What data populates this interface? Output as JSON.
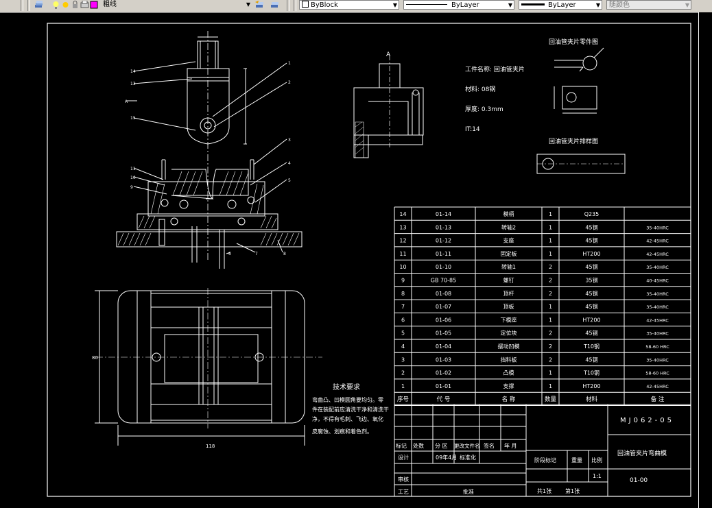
{
  "toolbar": {
    "layer_name": "粗线",
    "color_control": "ByBlock",
    "linetype_control": "ByLayer",
    "lineweight_control": "ByLayer",
    "plotstyle_control": "随颜色"
  },
  "drawing": {
    "section_label_a": "A",
    "part_drawing_title": "回油管夹片零件图",
    "blank_drawing_title": "回油管夹片排样图",
    "workpiece_name": "工件名称: 回油管夹片",
    "material": "材料: 08钢",
    "thickness": "厚度: 0.3mm",
    "tolerance": "IT:14",
    "tech_req_title": "技术要求",
    "tech_req_lines": [
      "弯曲凸、凹模圆角要均匀。零",
      "件在装配前应清洗干净和清洗干",
      "净，不得有毛刺、飞边、氧化",
      "皮腐蚀、划痕和着色剂。"
    ],
    "dim_overall_width": "118",
    "dim_height_left": "80",
    "callouts": [
      "14",
      "13",
      "A",
      "15",
      "1",
      "2",
      "11",
      "10",
      "9",
      "3",
      "4",
      "5",
      "6",
      "7",
      "8"
    ]
  },
  "bom": {
    "rows": [
      {
        "no": "14",
        "code": "01-14",
        "name": "模柄",
        "qty": "1",
        "material": "Q235",
        "note": ""
      },
      {
        "no": "13",
        "code": "01-13",
        "name": "转轴2",
        "qty": "1",
        "material": "45钢",
        "note": "35-40HRC"
      },
      {
        "no": "12",
        "code": "01-12",
        "name": "支座",
        "qty": "1",
        "material": "45钢",
        "note": "42-45HRC"
      },
      {
        "no": "11",
        "code": "01-11",
        "name": "固定板",
        "qty": "1",
        "material": "HT200",
        "note": "42-45HRC"
      },
      {
        "no": "10",
        "code": "01-10",
        "name": "转轴1",
        "qty": "2",
        "material": "45钢",
        "note": "35-40HRC"
      },
      {
        "no": "9",
        "code": "GB 70-85",
        "name": "螺钉",
        "qty": "2",
        "material": "35钢",
        "note": "40-45HRC"
      },
      {
        "no": "8",
        "code": "01-08",
        "name": "顶杆",
        "qty": "2",
        "material": "45钢",
        "note": "35-40HRC"
      },
      {
        "no": "7",
        "code": "01-07",
        "name": "顶板",
        "qty": "1",
        "material": "45钢",
        "note": "35-40HRC"
      },
      {
        "no": "6",
        "code": "01-06",
        "name": "下模座",
        "qty": "1",
        "material": "HT200",
        "note": "42-45HRC"
      },
      {
        "no": "5",
        "code": "01-05",
        "name": "定位块",
        "qty": "2",
        "material": "45钢",
        "note": "35-40HRC"
      },
      {
        "no": "4",
        "code": "01-04",
        "name": "摆动凹模",
        "qty": "2",
        "material": "T10钢",
        "note": "58-60 HRC"
      },
      {
        "no": "3",
        "code": "01-03",
        "name": "挡料板",
        "qty": "2",
        "material": "45钢",
        "note": "35-40HRC"
      },
      {
        "no": "2",
        "code": "01-02",
        "name": "凸模",
        "qty": "1",
        "material": "T10钢",
        "note": "58-60 HRC"
      },
      {
        "no": "1",
        "code": "01-01",
        "name": "支撑",
        "qty": "1",
        "material": "HT200",
        "note": "42-45HRC"
      }
    ],
    "header": {
      "no": "序号",
      "code": "代  号",
      "name": "名  称",
      "qty": "数量",
      "material": "材料",
      "note": "备  注"
    }
  },
  "title_block": {
    "drawing_number": "MJ062-05",
    "drawing_name": "回油管夹片弯曲模",
    "part_number": "01-00",
    "row_labels": [
      "标记",
      "处数",
      "分 区",
      "更改文件名",
      "签名",
      "年 月"
    ],
    "designer_label": "设计",
    "date_text": "09年4月",
    "standardize_label": "标准化",
    "review_label": "审核",
    "process_label": "工艺",
    "approve_label": "批准",
    "stage_mark": "阶段标记",
    "weight": "重量",
    "scale_label": "比例",
    "scale_value": "1:1",
    "sheets": "共1张",
    "sheet_no": "第1张"
  }
}
